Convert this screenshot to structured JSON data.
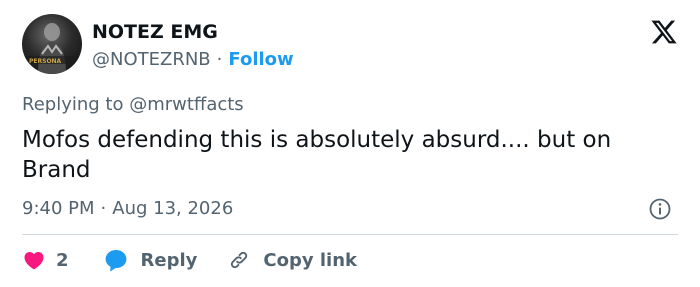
{
  "author": {
    "display_name": "NOTEZ EMG",
    "handle": "@NOTEZRNB",
    "follow_label": "Follow",
    "separator": "·"
  },
  "reply_context": {
    "prefix": "Replying to ",
    "target": "@mrwtffacts"
  },
  "tweet": {
    "text": "Mofos defending this is absolutely absurd.... but on Brand",
    "time": "9:40 PM",
    "date": "Aug 13, 2026"
  },
  "actions": {
    "like_count": "2",
    "reply_label": "Reply",
    "copy_label": "Copy link"
  },
  "icons": {
    "brand": "x-logo-icon",
    "info": "info-icon",
    "like": "heart-icon",
    "reply": "speech-bubble-icon",
    "copy": "link-icon"
  },
  "colors": {
    "text_primary": "#0f1419",
    "text_secondary": "#536471",
    "accent_blue": "#1d9bf0",
    "like_pink": "#f91880",
    "divider": "#cfd9de"
  }
}
